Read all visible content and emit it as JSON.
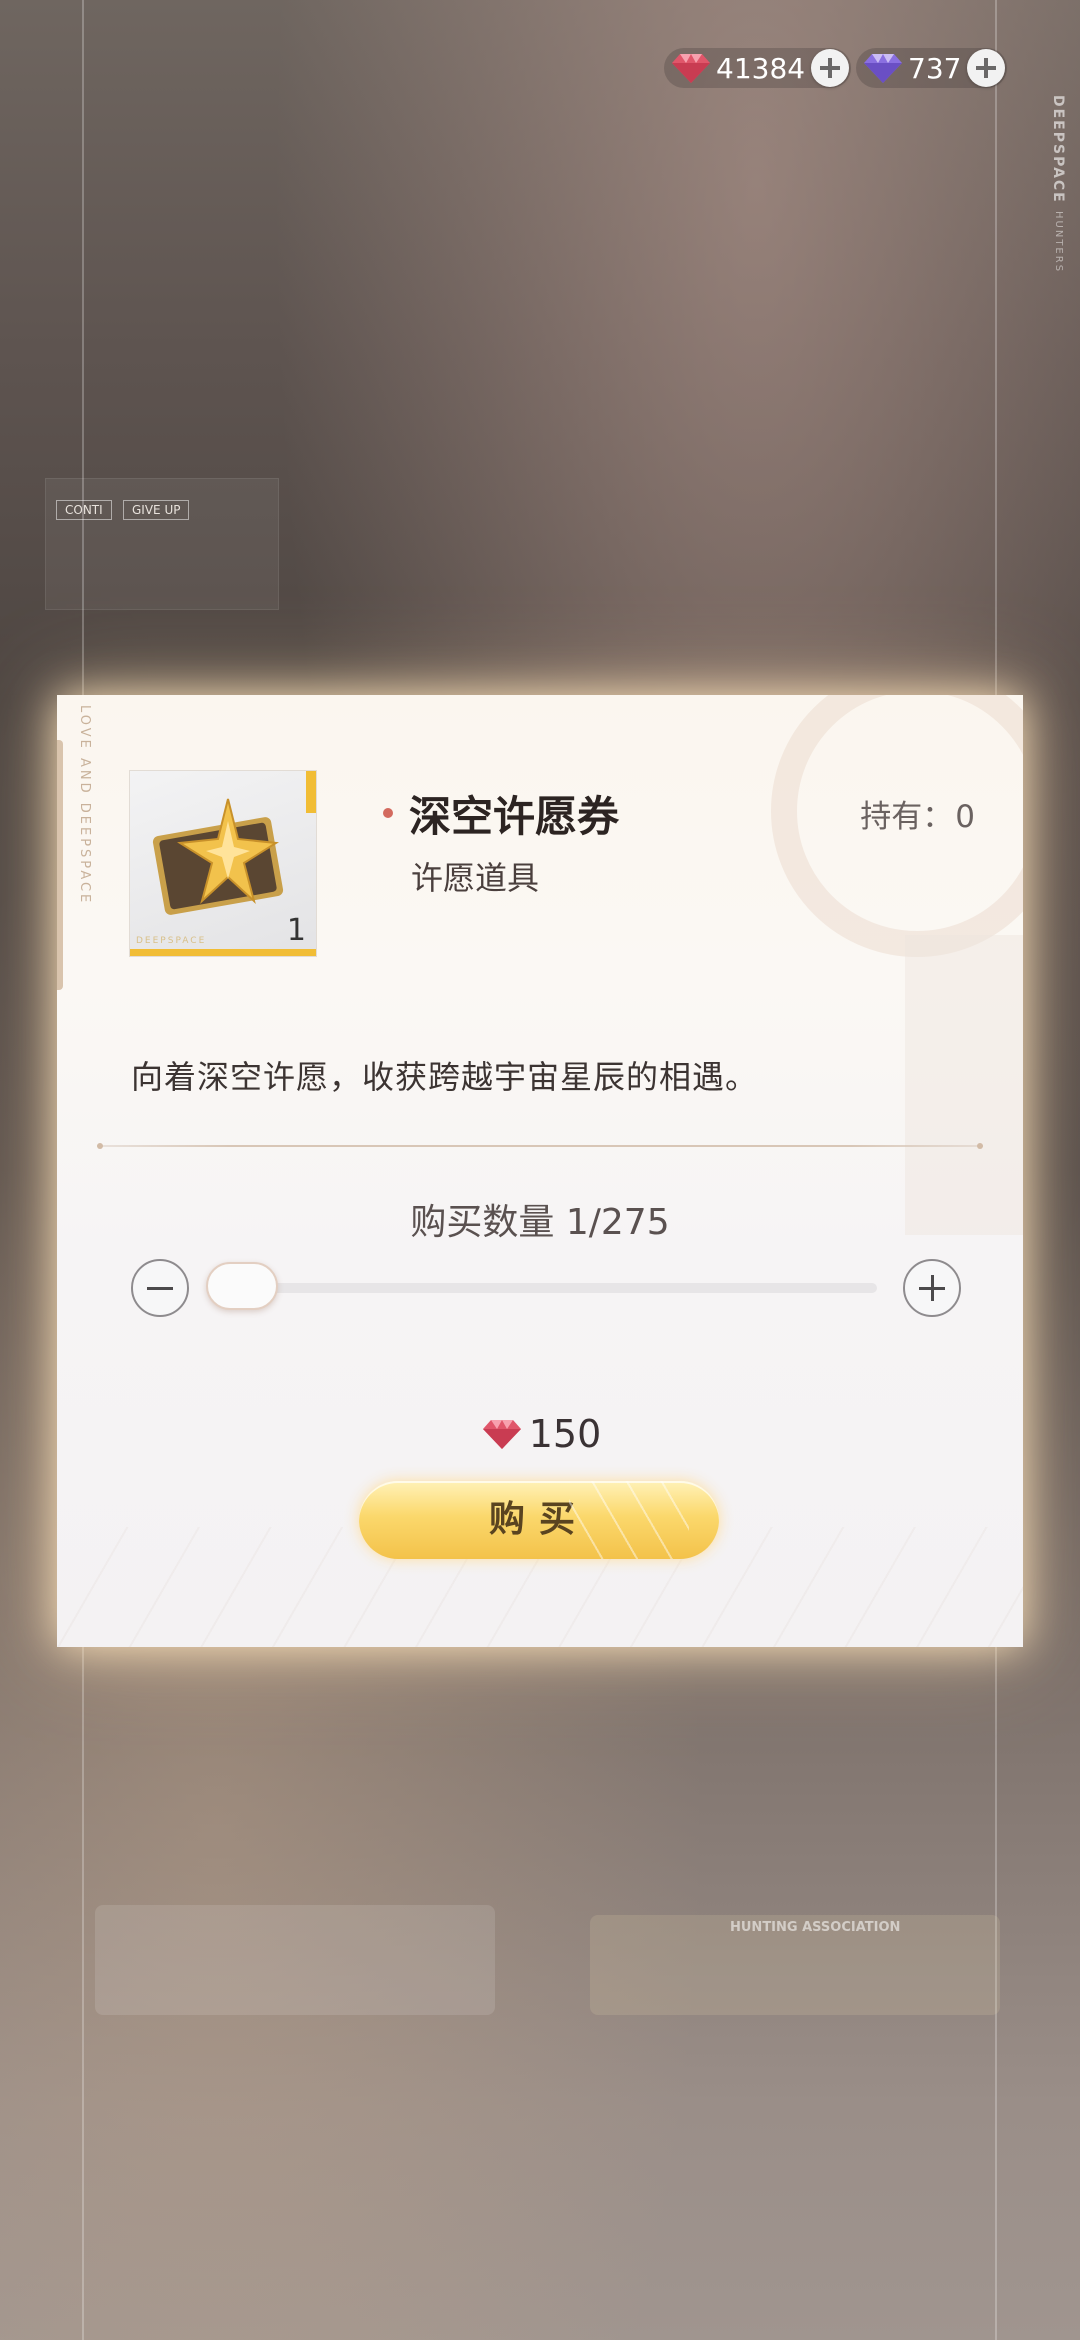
{
  "currencies": [
    {
      "name": "red-diamond",
      "amount": "41384",
      "color": "#e0566a"
    },
    {
      "name": "purple-diamond",
      "amount": "737",
      "color": "#8a6fe0"
    }
  ],
  "background": {
    "side_brand": "DEEPSPACE",
    "side_brand_sub": "HUNTERS",
    "chip_continue": "CONTI",
    "chip_giveup": "GIVE UP",
    "association_text": "HUNTING ASSOCIATION"
  },
  "dialog": {
    "edge_text": "LOVE AND DEEPSPACE",
    "item": {
      "name": "深空许愿券",
      "type": "许愿道具",
      "owned_label": "持有：",
      "owned_value": "0",
      "thumb_count": "1",
      "thumb_brand": "DEEPSPACE",
      "description": "向着深空许愿，收获跨越宇宙星辰的相遇。"
    },
    "quantity": {
      "label": "购买数量",
      "current": "1",
      "max": "275",
      "display": "1/275",
      "slider_fraction": 0.0036
    },
    "price": "150",
    "buy_label": "购买"
  },
  "colors": {
    "accent_gold": "#f3c24a",
    "dot_red": "#d36a5e"
  }
}
